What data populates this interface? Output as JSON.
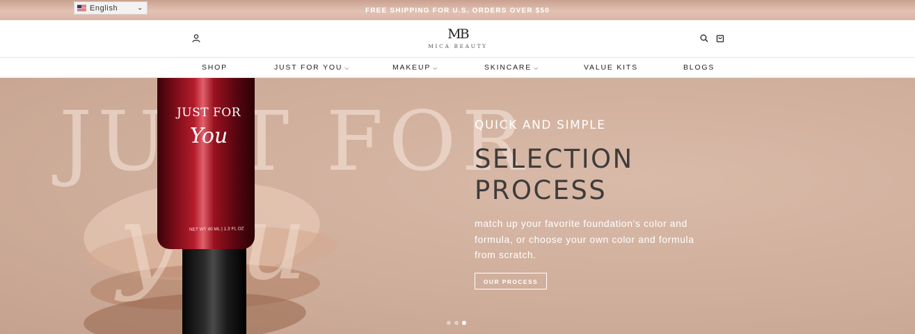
{
  "announcement": "FREE SHIPPING FOR U.S. ORDERS OVER $50",
  "language": {
    "selected": "English",
    "flag_icon": "us-flag-icon"
  },
  "header": {
    "logo_mark": "MB",
    "logo_text": "MICA BEAUTY",
    "icons": [
      "user-icon",
      "search-icon",
      "cart-icon"
    ]
  },
  "nav": {
    "items": [
      {
        "label": "SHOP",
        "has_dropdown": false
      },
      {
        "label": "JUST FOR YOU",
        "has_dropdown": true
      },
      {
        "label": "MAKEUP",
        "has_dropdown": true
      },
      {
        "label": "SKINCARE",
        "has_dropdown": true
      },
      {
        "label": "VALUE KITS",
        "has_dropdown": false
      },
      {
        "label": "BLOGS",
        "has_dropdown": false
      }
    ]
  },
  "hero": {
    "backdrop_text": "JUST FOR",
    "backdrop_script": "you",
    "product_title": "JUST FOR",
    "product_script": "You",
    "product_net": "NET WT 40 ML | 1.3 FL OZ",
    "kicker": "QUICK AND SIMPLE",
    "headline_line1": "SELECTION",
    "headline_line2": "PROCESS",
    "body": "match up your favorite foundation's color and formula, or choose your own color and formula from scratch.",
    "cta_label": "OUR PROCESS",
    "slides_total": 3,
    "slide_active": 3
  },
  "colors": {
    "accent": "#d4b2a2",
    "headline": "#3f3c3a",
    "tube": "#9a1220"
  }
}
